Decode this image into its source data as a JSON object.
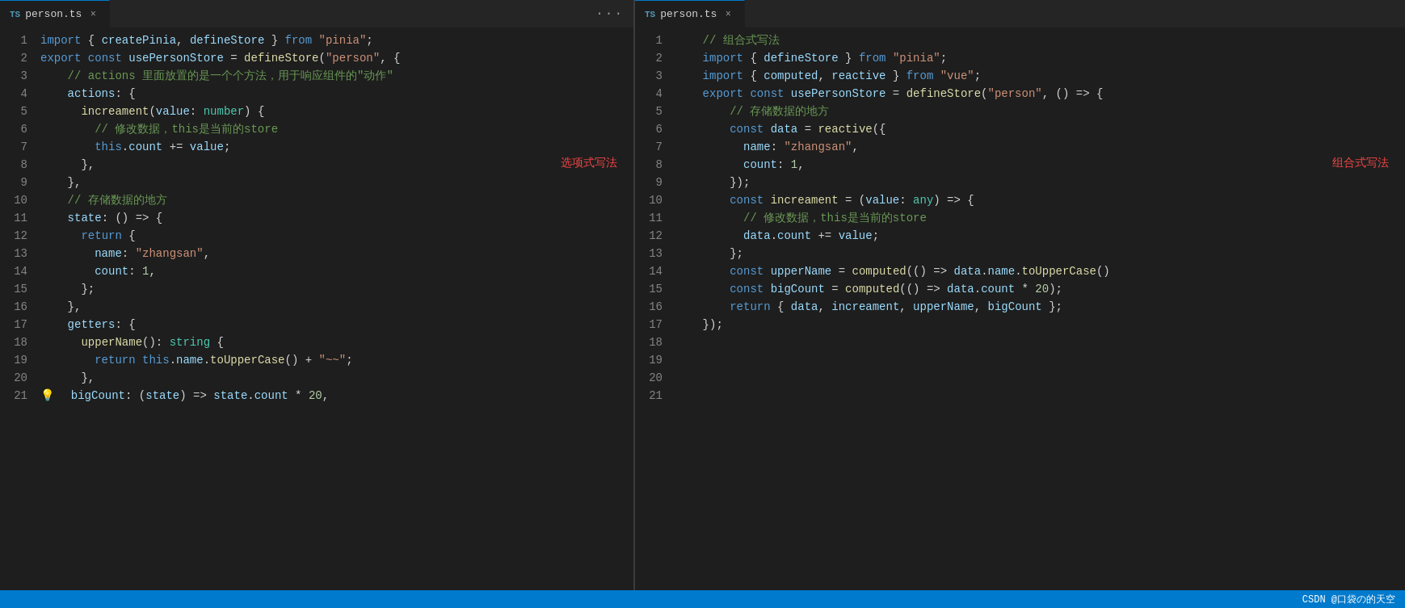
{
  "left_pane": {
    "tab": {
      "label": "person.ts",
      "icon": "TS",
      "active": true
    },
    "annotation": "选项式写法",
    "lines": [
      {
        "num": 1,
        "tokens": [
          {
            "t": "kw",
            "v": "import"
          },
          {
            "t": "op",
            "v": " { "
          },
          {
            "t": "var-blue",
            "v": "createPinia"
          },
          {
            "t": "op",
            "v": ", "
          },
          {
            "t": "var-blue",
            "v": "defineStore"
          },
          {
            "t": "op",
            "v": " } "
          },
          {
            "t": "kw",
            "v": "from"
          },
          {
            "t": "op",
            "v": " "
          },
          {
            "t": "str",
            "v": "\"pinia\""
          },
          {
            "t": "op",
            "v": ";"
          }
        ]
      },
      {
        "num": 2,
        "tokens": [
          {
            "t": "kw",
            "v": "export"
          },
          {
            "t": "op",
            "v": " "
          },
          {
            "t": "kw",
            "v": "const"
          },
          {
            "t": "op",
            "v": " "
          },
          {
            "t": "var-blue",
            "v": "usePersonStore"
          },
          {
            "t": "op",
            "v": " = "
          },
          {
            "t": "fn",
            "v": "defineStore"
          },
          {
            "t": "op",
            "v": "("
          },
          {
            "t": "str",
            "v": "\"person\""
          },
          {
            "t": "op",
            "v": ", {"
          }
        ]
      },
      {
        "num": 3,
        "tokens": [
          {
            "t": "cm",
            "v": "    // actions 里面放置的是一个个方法，用于响应组件的\"动作\""
          }
        ]
      },
      {
        "num": 4,
        "tokens": [
          {
            "t": "op",
            "v": "    "
          },
          {
            "t": "var-blue",
            "v": "actions"
          },
          {
            "t": "op",
            "v": ": {"
          }
        ]
      },
      {
        "num": 5,
        "tokens": [
          {
            "t": "op",
            "v": "      "
          },
          {
            "t": "fn",
            "v": "increament"
          },
          {
            "t": "op",
            "v": "("
          },
          {
            "t": "param",
            "v": "value"
          },
          {
            "t": "op",
            "v": ": "
          },
          {
            "t": "type",
            "v": "number"
          },
          {
            "t": "op",
            "v": ") {"
          }
        ]
      },
      {
        "num": 6,
        "tokens": [
          {
            "t": "cm",
            "v": "        // 修改数据，this是当前的store"
          }
        ]
      },
      {
        "num": 7,
        "tokens": [
          {
            "t": "op",
            "v": "        "
          },
          {
            "t": "kw",
            "v": "this"
          },
          {
            "t": "op",
            "v": "."
          },
          {
            "t": "var-blue",
            "v": "count"
          },
          {
            "t": "op",
            "v": " += "
          },
          {
            "t": "param",
            "v": "value"
          },
          {
            "t": "op",
            "v": ";"
          }
        ]
      },
      {
        "num": 8,
        "tokens": [
          {
            "t": "op",
            "v": "      "
          },
          {
            "t": "op",
            "v": "},"
          }
        ]
      },
      {
        "num": 9,
        "tokens": [
          {
            "t": "op",
            "v": "    "
          },
          {
            "t": "op",
            "v": "},"
          }
        ]
      },
      {
        "num": 10,
        "tokens": [
          {
            "t": "cm",
            "v": "    // 存储数据的地方"
          }
        ]
      },
      {
        "num": 11,
        "tokens": [
          {
            "t": "op",
            "v": "    "
          },
          {
            "t": "var-blue",
            "v": "state"
          },
          {
            "t": "op",
            "v": ": () => {"
          }
        ]
      },
      {
        "num": 12,
        "tokens": [
          {
            "t": "op",
            "v": "      "
          },
          {
            "t": "kw",
            "v": "return"
          },
          {
            "t": "op",
            "v": " {"
          }
        ]
      },
      {
        "num": 13,
        "tokens": [
          {
            "t": "op",
            "v": "        "
          },
          {
            "t": "var-blue",
            "v": "name"
          },
          {
            "t": "op",
            "v": ": "
          },
          {
            "t": "str",
            "v": "\"zhangsan\""
          },
          {
            "t": "op",
            "v": ","
          }
        ]
      },
      {
        "num": 14,
        "tokens": [
          {
            "t": "op",
            "v": "        "
          },
          {
            "t": "var-blue",
            "v": "count"
          },
          {
            "t": "op",
            "v": ": "
          },
          {
            "t": "num",
            "v": "1"
          },
          {
            "t": "op",
            "v": ","
          }
        ]
      },
      {
        "num": 15,
        "tokens": [
          {
            "t": "op",
            "v": "      "
          },
          {
            "t": "op",
            "v": "};"
          }
        ]
      },
      {
        "num": 16,
        "tokens": [
          {
            "t": "op",
            "v": "    "
          },
          {
            "t": "op",
            "v": "},"
          }
        ]
      },
      {
        "num": 17,
        "tokens": [
          {
            "t": "op",
            "v": "    "
          },
          {
            "t": "var-blue",
            "v": "getters"
          },
          {
            "t": "op",
            "v": ": {"
          }
        ]
      },
      {
        "num": 18,
        "tokens": [
          {
            "t": "op",
            "v": "      "
          },
          {
            "t": "fn",
            "v": "upperName"
          },
          {
            "t": "op",
            "v": "(): "
          },
          {
            "t": "type",
            "v": "string"
          },
          {
            "t": "op",
            "v": " {"
          }
        ]
      },
      {
        "num": 19,
        "tokens": [
          {
            "t": "op",
            "v": "        "
          },
          {
            "t": "kw",
            "v": "return"
          },
          {
            "t": "op",
            "v": " "
          },
          {
            "t": "kw",
            "v": "this"
          },
          {
            "t": "op",
            "v": "."
          },
          {
            "t": "var-blue",
            "v": "name"
          },
          {
            "t": "op",
            "v": "."
          },
          {
            "t": "fn",
            "v": "toUpperCase"
          },
          {
            "t": "op",
            "v": "() + "
          },
          {
            "t": "str",
            "v": "\"~~\""
          },
          {
            "t": "op",
            "v": ";"
          }
        ]
      },
      {
        "num": 20,
        "tokens": [
          {
            "t": "op",
            "v": "      "
          },
          {
            "t": "op",
            "v": "},"
          }
        ]
      },
      {
        "num": 21,
        "tokens": [
          {
            "t": "lightbulb",
            "v": "💡"
          },
          {
            "t": "op",
            "v": "  "
          },
          {
            "t": "var-blue",
            "v": "bigCount"
          },
          {
            "t": "op",
            "v": ": ("
          },
          {
            "t": "param",
            "v": "state"
          },
          {
            "t": "op",
            "v": ") => "
          },
          {
            "t": "var-blue",
            "v": "state"
          },
          {
            "t": "op",
            "v": "."
          },
          {
            "t": "var-blue",
            "v": "count"
          },
          {
            "t": "op",
            "v": " * "
          },
          {
            "t": "num",
            "v": "20"
          },
          {
            "t": "op",
            "v": ","
          }
        ]
      }
    ]
  },
  "right_pane": {
    "tab": {
      "label": "person.ts",
      "icon": "TS",
      "active": true
    },
    "annotation": "组合式写法",
    "lines": [
      {
        "num": 1,
        "tokens": [
          {
            "t": "cm",
            "v": "    // 组合式写法"
          }
        ]
      },
      {
        "num": 2,
        "tokens": [
          {
            "t": "kw",
            "v": "    import"
          },
          {
            "t": "op",
            "v": " { "
          },
          {
            "t": "var-blue",
            "v": "defineStore"
          },
          {
            "t": "op",
            "v": " } "
          },
          {
            "t": "kw",
            "v": "from"
          },
          {
            "t": "op",
            "v": " "
          },
          {
            "t": "str",
            "v": "\"pinia\""
          },
          {
            "t": "op",
            "v": ";"
          }
        ]
      },
      {
        "num": 3,
        "tokens": [
          {
            "t": "kw",
            "v": "    import"
          },
          {
            "t": "op",
            "v": " { "
          },
          {
            "t": "var-blue",
            "v": "computed"
          },
          {
            "t": "op",
            "v": ", "
          },
          {
            "t": "var-blue",
            "v": "reactive"
          },
          {
            "t": "op",
            "v": " } "
          },
          {
            "t": "kw",
            "v": "from"
          },
          {
            "t": "op",
            "v": " "
          },
          {
            "t": "str",
            "v": "\"vue\""
          },
          {
            "t": "op",
            "v": ";"
          }
        ]
      },
      {
        "num": 4,
        "tokens": []
      },
      {
        "num": 5,
        "tokens": [
          {
            "t": "kw",
            "v": "    export"
          },
          {
            "t": "op",
            "v": " "
          },
          {
            "t": "kw",
            "v": "const"
          },
          {
            "t": "op",
            "v": " "
          },
          {
            "t": "var-blue",
            "v": "usePersonStore"
          },
          {
            "t": "op",
            "v": " = "
          },
          {
            "t": "fn",
            "v": "defineStore"
          },
          {
            "t": "op",
            "v": "("
          },
          {
            "t": "str",
            "v": "\"person\""
          },
          {
            "t": "op",
            "v": ", () => {"
          }
        ]
      },
      {
        "num": 6,
        "tokens": [
          {
            "t": "cm",
            "v": "        // 存储数据的地方"
          }
        ]
      },
      {
        "num": 7,
        "tokens": [
          {
            "t": "op",
            "v": "        "
          },
          {
            "t": "kw",
            "v": "const"
          },
          {
            "t": "op",
            "v": " "
          },
          {
            "t": "var-blue",
            "v": "data"
          },
          {
            "t": "op",
            "v": " = "
          },
          {
            "t": "fn",
            "v": "reactive"
          },
          {
            "t": "op",
            "v": "({"
          }
        ]
      },
      {
        "num": 8,
        "tokens": [
          {
            "t": "op",
            "v": "          "
          },
          {
            "t": "var-blue",
            "v": "name"
          },
          {
            "t": "op",
            "v": ": "
          },
          {
            "t": "str",
            "v": "\"zhangsan\""
          },
          {
            "t": "op",
            "v": ","
          }
        ]
      },
      {
        "num": 9,
        "tokens": [
          {
            "t": "op",
            "v": "          "
          },
          {
            "t": "var-blue",
            "v": "count"
          },
          {
            "t": "op",
            "v": ": "
          },
          {
            "t": "num",
            "v": "1"
          },
          {
            "t": "op",
            "v": ","
          }
        ]
      },
      {
        "num": 10,
        "tokens": [
          {
            "t": "op",
            "v": "        "
          },
          {
            "t": "op",
            "v": "});"
          }
        ]
      },
      {
        "num": 11,
        "tokens": [
          {
            "t": "op",
            "v": "        "
          },
          {
            "t": "kw",
            "v": "const"
          },
          {
            "t": "op",
            "v": " "
          },
          {
            "t": "fn",
            "v": "increament"
          },
          {
            "t": "op",
            "v": " = ("
          },
          {
            "t": "param",
            "v": "value"
          },
          {
            "t": "op",
            "v": ": "
          },
          {
            "t": "type",
            "v": "any"
          },
          {
            "t": "op",
            "v": ") => {"
          }
        ]
      },
      {
        "num": 12,
        "tokens": [
          {
            "t": "cm",
            "v": "          // 修改数据，this是当前的store"
          }
        ]
      },
      {
        "num": 13,
        "tokens": [
          {
            "t": "op",
            "v": "          "
          },
          {
            "t": "var-blue",
            "v": "data"
          },
          {
            "t": "op",
            "v": "."
          },
          {
            "t": "var-blue",
            "v": "count"
          },
          {
            "t": "op",
            "v": " += "
          },
          {
            "t": "param",
            "v": "value"
          },
          {
            "t": "op",
            "v": ";"
          }
        ]
      },
      {
        "num": 14,
        "tokens": [
          {
            "t": "op",
            "v": "        "
          },
          {
            "t": "op",
            "v": "};"
          }
        ]
      },
      {
        "num": 15,
        "tokens": []
      },
      {
        "num": 16,
        "tokens": [
          {
            "t": "op",
            "v": "        "
          },
          {
            "t": "kw",
            "v": "const"
          },
          {
            "t": "op",
            "v": " "
          },
          {
            "t": "var-blue",
            "v": "upperName"
          },
          {
            "t": "op",
            "v": " = "
          },
          {
            "t": "fn",
            "v": "computed"
          },
          {
            "t": "op",
            "v": "(() => "
          },
          {
            "t": "var-blue",
            "v": "data"
          },
          {
            "t": "op",
            "v": "."
          },
          {
            "t": "var-blue",
            "v": "name"
          },
          {
            "t": "op",
            "v": "."
          },
          {
            "t": "fn",
            "v": "toUpperCase"
          },
          {
            "t": "op",
            "v": "()"
          }
        ]
      },
      {
        "num": 17,
        "tokens": [
          {
            "t": "op",
            "v": "        "
          },
          {
            "t": "kw",
            "v": "const"
          },
          {
            "t": "op",
            "v": " "
          },
          {
            "t": "var-blue",
            "v": "bigCount"
          },
          {
            "t": "op",
            "v": " = "
          },
          {
            "t": "fn",
            "v": "computed"
          },
          {
            "t": "op",
            "v": "(() => "
          },
          {
            "t": "var-blue",
            "v": "data"
          },
          {
            "t": "op",
            "v": "."
          },
          {
            "t": "var-blue",
            "v": "count"
          },
          {
            "t": "op",
            "v": " * "
          },
          {
            "t": "num",
            "v": "20"
          },
          {
            "t": "op",
            "v": ");"
          }
        ]
      },
      {
        "num": 18,
        "tokens": []
      },
      {
        "num": 19,
        "tokens": [
          {
            "t": "op",
            "v": "        "
          },
          {
            "t": "kw",
            "v": "return"
          },
          {
            "t": "op",
            "v": " { "
          },
          {
            "t": "var-blue",
            "v": "data"
          },
          {
            "t": "op",
            "v": ", "
          },
          {
            "t": "var-blue",
            "v": "increament"
          },
          {
            "t": "op",
            "v": ", "
          },
          {
            "t": "var-blue",
            "v": "upperName"
          },
          {
            "t": "op",
            "v": ", "
          },
          {
            "t": "var-blue",
            "v": "bigCount"
          },
          {
            "t": "op",
            "v": " };"
          }
        ]
      },
      {
        "num": 20,
        "tokens": [
          {
            "t": "op",
            "v": "    "
          },
          {
            "t": "op",
            "v": "});"
          }
        ]
      },
      {
        "num": 21,
        "tokens": []
      }
    ]
  },
  "bottom_bar": {
    "watermark": "CSDN @口袋の的天空"
  }
}
